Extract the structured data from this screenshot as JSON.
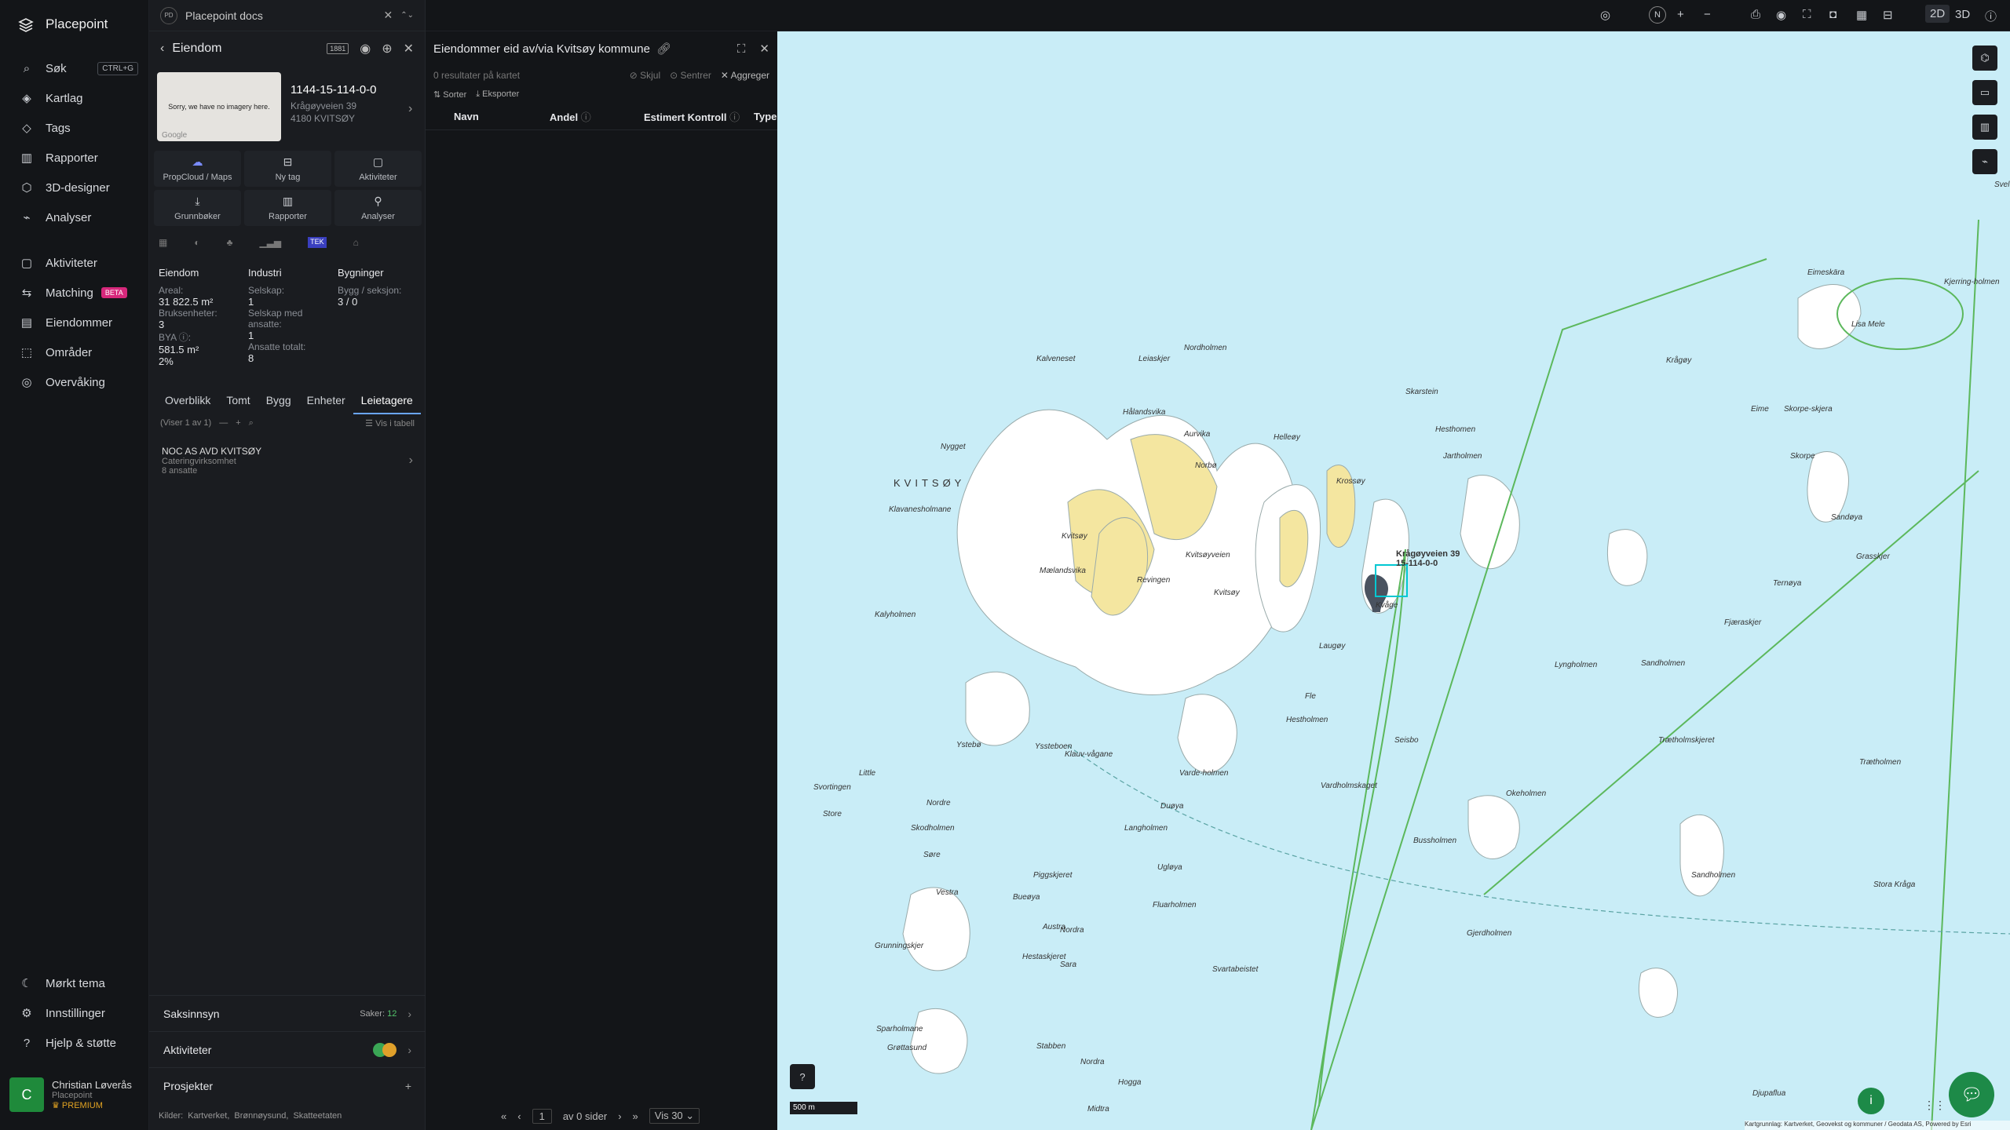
{
  "brand": {
    "name": "Placepoint"
  },
  "nav": {
    "items": [
      {
        "label": "Søk",
        "icon": "search-icon",
        "kbd": "CTRL+G"
      },
      {
        "label": "Kartlag",
        "icon": "layers-icon"
      },
      {
        "label": "Tags",
        "icon": "tag-icon"
      },
      {
        "label": "Rapporter",
        "icon": "chart-icon"
      },
      {
        "label": "3D-designer",
        "icon": "cube-icon"
      },
      {
        "label": "Analyser",
        "icon": "analysis-icon"
      },
      {
        "label": "Aktiviteter",
        "icon": "chat-icon"
      },
      {
        "label": "Matching",
        "icon": "match-icon",
        "badge": "BETA"
      },
      {
        "label": "Eiendommer",
        "icon": "building-icon"
      },
      {
        "label": "Områder",
        "icon": "area-icon"
      },
      {
        "label": "Overvåking",
        "icon": "watch-icon"
      }
    ],
    "bottom": [
      {
        "label": "Mørkt tema"
      },
      {
        "label": "Innstillinger"
      },
      {
        "label": "Hjelp & støtte"
      }
    ],
    "user": {
      "initial": "C",
      "name": "Christian Løverås",
      "org": "Placepoint",
      "plan": "PREMIUM"
    }
  },
  "doc_tab": {
    "label": "Placepoint docs",
    "icon": "PD"
  },
  "property": {
    "header": "Eiendom",
    "badge": "1881",
    "image_text": "Sorry, we have no imagery here.",
    "image_credit": "Google",
    "id": "1144-15-114-0-0",
    "address": "Krågøyveien 39",
    "postal": "4180 KVITSØY",
    "actions": [
      "PropCloud / Maps",
      "Ny tag",
      "Aktiviteter",
      "Grunnbøker",
      "Rapporter",
      "Analyser"
    ],
    "stat_cols": [
      {
        "title": "Eiendom",
        "rows": [
          {
            "label": "Areal:",
            "value": "31 822.5 m²"
          },
          {
            "label": "Bruksenheter:",
            "value": "3"
          },
          {
            "label": "BYA ⓘ:",
            "value": "581.5 m²"
          },
          {
            "label": "",
            "value": "2%"
          }
        ]
      },
      {
        "title": "Industri",
        "rows": [
          {
            "label": "Selskap:",
            "value": "1"
          },
          {
            "label": "Selskap med ansatte:",
            "value": "1"
          },
          {
            "label": "Ansatte totalt:",
            "value": "8"
          }
        ]
      },
      {
        "title": "Bygninger",
        "rows": [
          {
            "label": "Bygg / seksjon:",
            "value": "3 / 0"
          }
        ]
      }
    ],
    "tabs": [
      "Overblikk",
      "Tomt",
      "Bygg",
      "Enheter",
      "Leietagere"
    ],
    "active_tab": "Leietagere",
    "list_info": "(Viser 1 av 1)",
    "vis_tabell": "Vis i tabell",
    "tenant": {
      "name": "NOC AS AVD KVITSØY",
      "type": "Cateringvirksomhet",
      "employees": "8 ansatte"
    },
    "saksinnsyn": {
      "label": "Saksinnsyn",
      "count_label": "Saker:",
      "count": "12"
    },
    "aktiviteter": "Aktiviteter",
    "prosjekter": "Prosjekter",
    "sources": {
      "label": "Kilder:",
      "items": [
        "Kartverket,",
        "Brønnøysund,",
        "Skatteetaten"
      ]
    }
  },
  "results": {
    "title": "Eiendommer eid av/via Kvitsøy kommune",
    "count_text": "0 resultater på kartet",
    "skjul": "Skjul",
    "sentrer": "Sentrer",
    "aggreger": "Aggreger",
    "sorter": "Sorter",
    "eksporter": "Eksporter",
    "columns": [
      "Navn",
      "Andel",
      "Estimert Kontroll",
      "Type"
    ],
    "pager": {
      "page": "1",
      "of": "av 0 sider",
      "per": "Vis 30"
    }
  },
  "toolbar": {
    "mode2d": "2D",
    "mode3d": "3D",
    "north": "N"
  },
  "map": {
    "scale": "500 m",
    "attribution": "Kartgrunnlag: Kartverket, Geovekst og kommuner / Geodata AS, Powered by Esri",
    "marker_label": "Krågøyveien 39",
    "marker_id": "15-114-0-0",
    "labels": [
      "KVITSØY",
      "Nordholmen",
      "Leiaskjer",
      "Kalveneset",
      "Hålandsvika",
      "Skarstein",
      "Hesthomen",
      "Jartholmen",
      "Krossøy",
      "Nygget",
      "Aurvika",
      "Norbø",
      "Helleøy",
      "Klavanesholmane",
      "Mælandsvika",
      "Revingen",
      "Kvitsøy",
      "Kvitsøyveien",
      "Kvåge",
      "Krågøy",
      "Lisa Mele",
      "Eime",
      "Skorpe-skjera",
      "Skorpe",
      "Sandøya",
      "Grasskjer",
      "Ternøya",
      "Fjæraskjer",
      "Lyngholmen",
      "Sandholmen",
      "Trætholmskjeret",
      "Trætholmen",
      "Seisbo",
      "Hestholmen",
      "Varde-holmen",
      "Duøya",
      "Langholmen",
      "Ugløya",
      "Fluarholmen",
      "Svartabeistet",
      "Bussholmen",
      "Gjerdholmen",
      "Sandholmen",
      "Stora Kråga",
      "Okeholmen",
      "Vardholmskaget",
      "Svortingen",
      "Store",
      "Nordre",
      "Skodholmen",
      "Søre",
      "Piggskjeret",
      "Vestra",
      "Bueøya",
      "Austra",
      "Nordra",
      "Hestaskjeret",
      "Sara",
      "Grunningskjer",
      "Sparholmane",
      "Grøttasund",
      "Stabben",
      "Nordra",
      "Hogga",
      "Midtra",
      "Djupaflua",
      "Yssteboen",
      "Ystebø",
      "Kalyholmen",
      "Little",
      "Klauv-vågane",
      "Fle",
      "Eimeskära",
      "Kjerring-holmen",
      "Svelta",
      "Laugøy",
      "Kvitsøy"
    ]
  }
}
